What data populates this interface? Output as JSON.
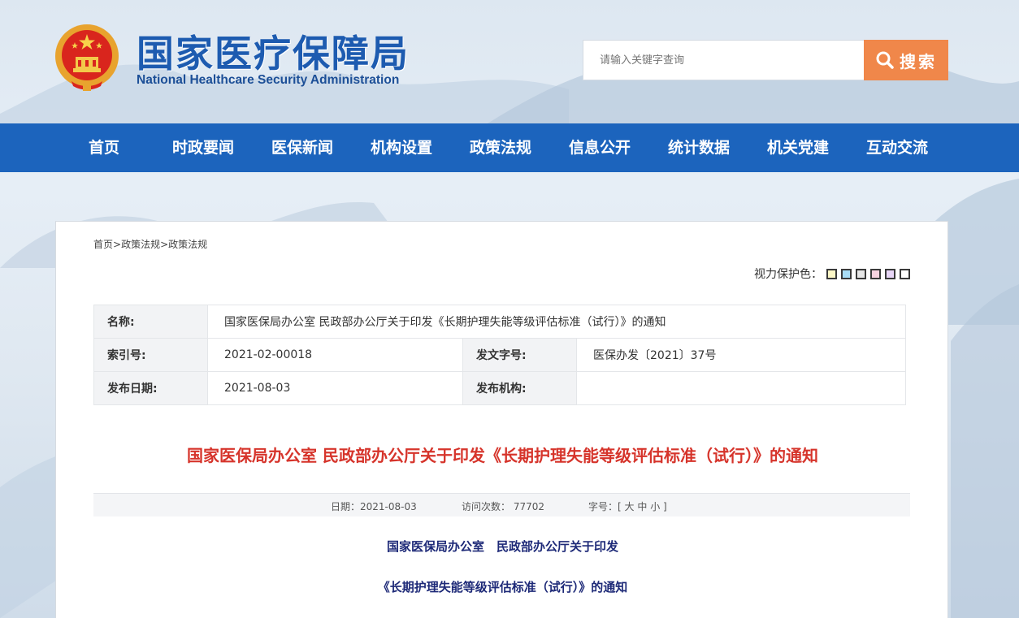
{
  "header": {
    "title_cn": "国家医疗保障局",
    "title_en": "National Healthcare Security Administration",
    "search_placeholder": "请输入关键字查询",
    "search_button": "搜索"
  },
  "nav": {
    "items": [
      {
        "label": "首页"
      },
      {
        "label": "时政要闻"
      },
      {
        "label": "医保新闻"
      },
      {
        "label": "机构设置"
      },
      {
        "label": "政策法规"
      },
      {
        "label": "信息公开"
      },
      {
        "label": "统计数据"
      },
      {
        "label": "机关党建"
      },
      {
        "label": "互动交流"
      }
    ]
  },
  "breadcrumb": {
    "items": [
      "首页",
      "政策法规",
      "政策法规"
    ],
    "separator": ">"
  },
  "eye_protection": {
    "label": "视力保护色：",
    "swatches": [
      "#fcf7c6",
      "#a8dcf5",
      "#e7e7e7",
      "#f7d3e0",
      "#e8d6f7",
      "#ffffff"
    ]
  },
  "info": {
    "name_label": "名称:",
    "name_value": "国家医保局办公室 民政部办公厅关于印发《长期护理失能等级评估标准（试行）》的通知",
    "index_label": "索引号:",
    "index_value": "2021-02-00018",
    "docno_label": "发文字号:",
    "docno_value": "医保办发〔2021〕37号",
    "date_label": "发布日期:",
    "date_value": "2021-08-03",
    "org_label": "发布机构:",
    "org_value": ""
  },
  "article": {
    "title": "国家医保局办公室 民政部办公厅关于印发《长期护理失能等级评估标准（试行）》的通知",
    "date_text": "日期：2021-08-03",
    "visits_text": "访问次数：  77702",
    "fontsize_label": "字号：[",
    "fontsize_large": "大",
    "fontsize_mid": "中",
    "fontsize_small": "小",
    "fontsize_end": "]",
    "subtitle_1": "国家医保局办公室　民政部办公厅关于印发",
    "subtitle_2": "《长期护理失能等级评估标准（试行）》的通知"
  },
  "colors": {
    "nav_bg": "#1c64bd",
    "search_button": "#f0874a",
    "title_red": "#d6342b",
    "subtitle_blue": "#1e2a78"
  }
}
